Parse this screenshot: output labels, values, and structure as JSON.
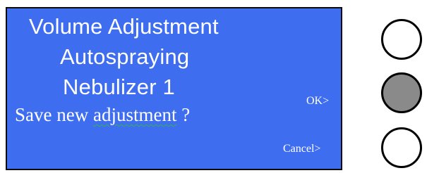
{
  "screen": {
    "background": "#3f6df0",
    "title": "Volume Adjustment",
    "subtitle": "Autospraying",
    "device": "Nebulizer 1",
    "question_prefix": "Save new ",
    "question_misspelled_word": "adjustment",
    "question_suffix": " ?",
    "ok_label": "OK>",
    "cancel_label": "Cancel>"
  },
  "buttons": {
    "top": {
      "state": "unpressed",
      "color": "#ffffff"
    },
    "middle": {
      "state": "pressed",
      "color": "#8a8a8a"
    },
    "bottom": {
      "state": "unpressed",
      "color": "#ffffff"
    }
  }
}
